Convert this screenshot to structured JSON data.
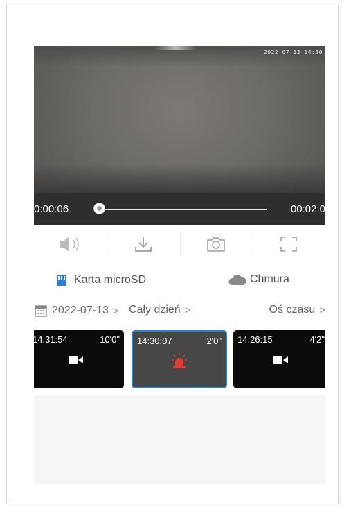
{
  "player": {
    "overlay_timestamp": "2022 07 13 14:30",
    "current_time": "0:00:06",
    "total_time": "00:02:0",
    "progress_fraction": 0.03
  },
  "toolbar": {
    "icons": [
      "speaker-icon",
      "download-icon",
      "camera-icon",
      "fullscreen-icon"
    ]
  },
  "sources": {
    "sd_label": "Karta microSD",
    "cloud_label": "Chmura",
    "accent": "#2f7fd6"
  },
  "filters": {
    "date": "2022-07-13",
    "range": "Cały dzień",
    "timeline": "Oś czasu"
  },
  "recordings": [
    {
      "time": "14:31:54",
      "duration": "10'0\"",
      "icon": "video-icon",
      "active": false
    },
    {
      "time": "14:30:07",
      "duration": "2'0\"",
      "icon": "alarm-icon",
      "active": true
    },
    {
      "time": "14:26:15",
      "duration": "4'2\"",
      "icon": "video-icon",
      "active": false
    }
  ],
  "colors": {
    "alarm": "#e53935",
    "selected_border": "#2f7fd6"
  }
}
